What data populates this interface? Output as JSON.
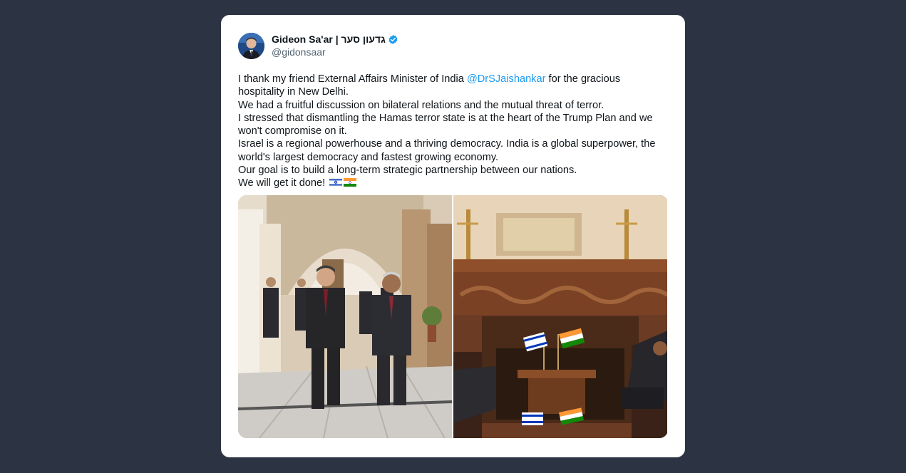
{
  "tweet": {
    "author": {
      "display_name": "Gideon Sa'ar | גדעון סער",
      "handle": "@gidonsaar",
      "verified": true,
      "verified_color": "#1d9bf0"
    },
    "text_lines": {
      "l1_before": "I thank my friend External Affairs Minister of India ",
      "l1_mention": "@DrSJaishankar",
      "l1_after": " for the gracious hospitality in New Delhi.",
      "l2": "We had a fruitful discussion on bilateral relations and the mutual threat of terror.",
      "l3": "I stressed that dismantling the Hamas terror state is at the heart of the Trump Plan and we won't compromise on it.",
      "l4": "Israel is a regional powerhouse and a thriving democracy. India is a global superpower, the world's largest democracy and fastest growing economy.",
      "l5": "Our goal is to build a long-term strategic partnership between our nations.",
      "l6": "We will get it done!"
    },
    "flags": [
      "israel-flag-icon",
      "india-flag-icon"
    ],
    "media": [
      {
        "name": "photo-walking-corridor"
      },
      {
        "name": "photo-meeting-room-flags"
      }
    ]
  },
  "colors": {
    "background": "#2c3444",
    "card": "#ffffff",
    "link": "#1d9bf0"
  }
}
